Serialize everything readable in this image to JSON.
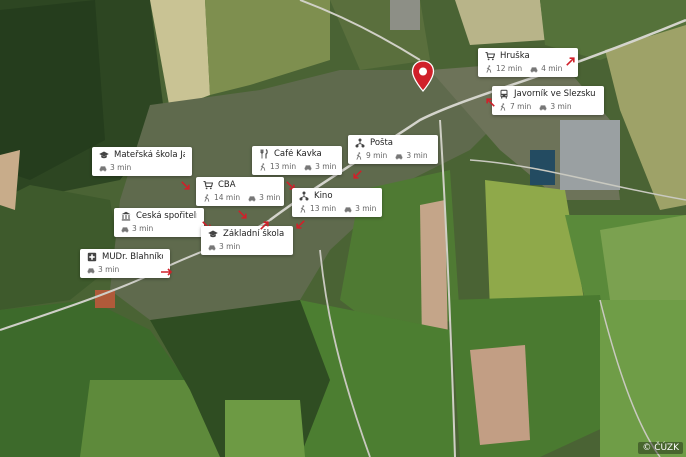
{
  "copyright": "© ČÚZK",
  "pois": [
    {
      "name": "Hruška",
      "icon": "cart-icon",
      "walk": "12 min",
      "car": "4 min"
    },
    {
      "name": "Javorník ve Slezsku",
      "icon": "bus-icon",
      "walk": "7 min",
      "car": "3 min"
    },
    {
      "name": "Mateřská škola Ja...",
      "icon": "graduation-cap-icon",
      "walk": "",
      "car": "3 min"
    },
    {
      "name": "Café Kavka",
      "icon": "cutlery-icon",
      "walk": "13 min",
      "car": "3 min"
    },
    {
      "name": "Pošta",
      "icon": "network-icon",
      "walk": "9 min",
      "car": "3 min"
    },
    {
      "name": "CBA",
      "icon": "cart-icon",
      "walk": "14 min",
      "car": "3 min"
    },
    {
      "name": "Kino",
      "icon": "network-icon",
      "walk": "13 min",
      "car": "3 min"
    },
    {
      "name": "Česká spořitelna",
      "icon": "bank-icon",
      "walk": "",
      "car": "3 min"
    },
    {
      "name": "Základní škola Ja...",
      "icon": "graduation-cap-icon",
      "walk": "",
      "car": "3 min"
    },
    {
      "name": "MUDr. Blahníková...",
      "icon": "medical-cross-icon",
      "walk": "",
      "car": "3 min"
    }
  ],
  "colors": {
    "pin": "#d0202a",
    "arrow": "#d0202a"
  }
}
